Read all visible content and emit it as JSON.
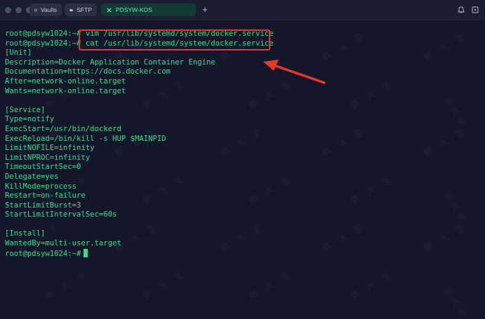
{
  "titlebar": {
    "tabs": [
      {
        "label": "Vaults",
        "icon": "vault-icon"
      },
      {
        "label": "SFTP",
        "icon": "folder-icon"
      },
      {
        "label": "PDSYW-KOS",
        "icon": "close-icon"
      }
    ]
  },
  "terminal": {
    "lines": [
      {
        "prompt": "root@pdsyw1024:~#",
        "text": " vim /usr/lib/systemd/system/docker.service"
      },
      {
        "prompt": "root@pdsyw1024:~#",
        "text": " cat /usr/lib/systemd/system/docker.service"
      },
      {
        "prompt": "",
        "text": "[Unit]"
      },
      {
        "prompt": "",
        "text": "Description=Docker Application Container Engine"
      },
      {
        "prompt": "",
        "text": "Documentation=https://docs.docker.com"
      },
      {
        "prompt": "",
        "text": "After=network-online.target"
      },
      {
        "prompt": "",
        "text": "Wants=network-online.target"
      },
      {
        "prompt": "",
        "text": ""
      },
      {
        "prompt": "",
        "text": "[Service]"
      },
      {
        "prompt": "",
        "text": "Type=notify"
      },
      {
        "prompt": "",
        "text": "ExecStart=/usr/bin/dockerd"
      },
      {
        "prompt": "",
        "text": "ExecReload=/bin/kill -s HUP $MAINPID"
      },
      {
        "prompt": "",
        "text": "LimitNOFILE=infinity"
      },
      {
        "prompt": "",
        "text": "LimitNPROC=infinity"
      },
      {
        "prompt": "",
        "text": "TimeoutStartSec=0"
      },
      {
        "prompt": "",
        "text": "Delegate=yes"
      },
      {
        "prompt": "",
        "text": "KillMode=process"
      },
      {
        "prompt": "",
        "text": "Restart=on-failure"
      },
      {
        "prompt": "",
        "text": "StartLimitBurst=3"
      },
      {
        "prompt": "",
        "text": "StartLimitIntervalSec=60s"
      },
      {
        "prompt": "",
        "text": ""
      },
      {
        "prompt": "",
        "text": "[Install]"
      },
      {
        "prompt": "",
        "text": "WantedBy=multi-user.target"
      }
    ],
    "final_prompt": "root@pdsyw1024:~#"
  },
  "watermark": "鹏大圣",
  "colors": {
    "terminal_text": "#2fe08e",
    "highlight": "#e8372c",
    "active_tab": "#6fe3c1"
  }
}
